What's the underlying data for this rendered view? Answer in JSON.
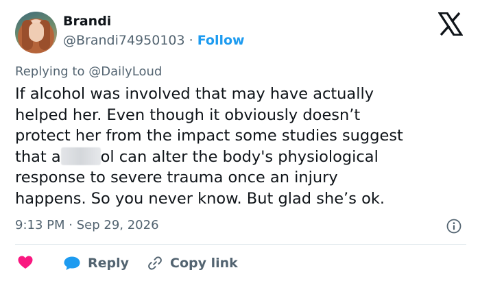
{
  "author": {
    "name": "Brandi",
    "handle": "@Brandi74950103",
    "separator": "·",
    "follow_label": "Follow"
  },
  "reply_context": {
    "prefix": "Replying to",
    "mention": "@DailyLoud"
  },
  "tweet": {
    "lines": [
      "If alcohol was involved that may have actually",
      "helped her. Even though it obviously doesn’t",
      "protect her from the impact some studies suggest"
    ],
    "line4_before_blur": "that a",
    "line4_after_blur": "ol can alter the body's physiological",
    "lines_after": [
      "response to severe trauma once an injury",
      "happens. So you never know. But glad she’s ok."
    ]
  },
  "meta": {
    "time": "9:13 PM",
    "separator": "·",
    "date": "Sep 29, 2026"
  },
  "actions": {
    "reply_label": "Reply",
    "copy_link_label": "Copy link"
  },
  "colors": {
    "accent": "#1d9bf0",
    "heart": "#f91880",
    "muted": "#536471",
    "text": "#0f1419"
  },
  "icons": {
    "platform": "x-logo-icon",
    "like": "heart-icon",
    "reply": "speech-bubble-icon",
    "copy": "link-icon",
    "info": "info-icon"
  }
}
